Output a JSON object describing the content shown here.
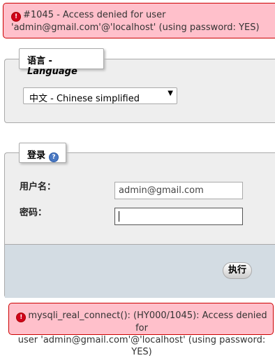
{
  "errors": {
    "top": {
      "icon": "error-icon",
      "line1": "#1045 - Access denied for user",
      "line2": "'admin@gmail.com'@'localhost' (using password: YES)"
    },
    "bottom": {
      "icon": "error-icon",
      "line1": "mysqli_real_connect(): (HY000/1045): Access denied for",
      "line2": "user 'admin@gmail.com'@'localhost' (using password: YES)"
    }
  },
  "language": {
    "legend_prefix": "语言 - ",
    "legend_em": "Language",
    "selected": "中文 - Chinese simplified"
  },
  "login": {
    "legend": "登录",
    "help_icon": "help-icon",
    "username_label": "用户名：",
    "username_value": "admin@gmail.com",
    "password_label": "密码：",
    "password_value": "",
    "submit": "执行"
  },
  "colors": {
    "error_bg": "#ffc0cb",
    "error_border": "#cc0000",
    "fieldset_bg": "#eeeeee",
    "footer_bg": "#d3dce3"
  }
}
